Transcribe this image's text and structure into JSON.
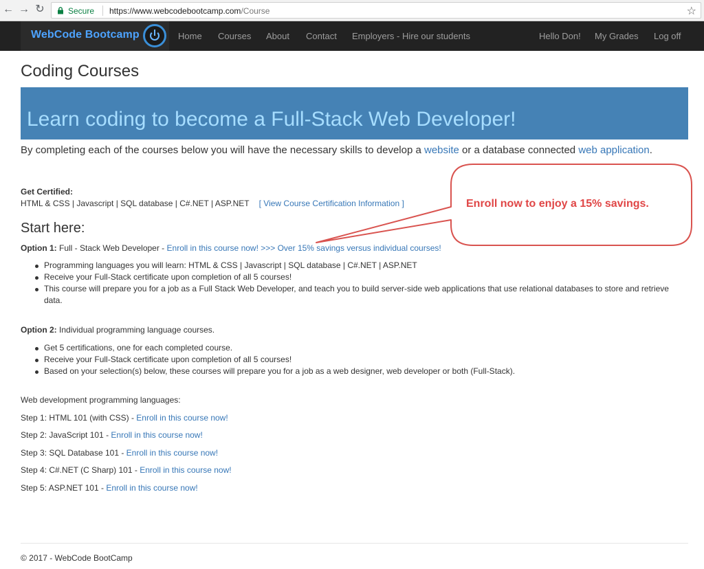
{
  "browser": {
    "secure_label": "Secure",
    "url_host": "https://www.webcodebootcamp.com",
    "url_path": "/Course"
  },
  "navbar": {
    "brand": "WebCode Bootcamp",
    "items": [
      "Home",
      "Courses",
      "About",
      "Contact",
      "Employers - Hire our students"
    ],
    "right_items": [
      "Hello Don!",
      "My Grades",
      "Log off"
    ]
  },
  "content": {
    "page_title": "Coding Courses",
    "jumbotron": "Learn coding to become a Full-Stack Web Developer!",
    "lead_before": "By completing each of the courses below you will have the necessary skills to develop a ",
    "lead_link1": "website",
    "lead_middle": " or a database connected ",
    "lead_link2": "web application",
    "lead_after": ".",
    "cert_heading": "Get Certified:",
    "cert_list": "HTML & CSS | Javascript | SQL database | C#.NET | ASP.NET",
    "cert_link": "[ View Course Certification Information ]",
    "start_heading": "Start here:",
    "option1": {
      "label": "Option 1:",
      "text": " Full - Stack Web Developer - ",
      "link": "Enroll in this course now! >>> Over 15% savings versus individual courses!",
      "bullets": [
        "Programming languages you will learn: HTML & CSS | Javascript | SQL database | C#.NET | ASP.NET",
        "Receive your Full-Stack certificate upon completion of all 5 courses!",
        "This course will prepare you for a job as a Full Stack Web Developer, and teach you to build server-side web applications that use relational databases to store and retrieve data."
      ]
    },
    "option2": {
      "label": "Option 2:",
      "text": " Individual programming language courses.",
      "bullets": [
        "Get 5 certifications, one for each completed course.",
        "Receive your Full-Stack certificate upon completion of all 5 courses!",
        "Based on your selection(s) below, these courses will prepare you for a job as a web designer, web developer or both (Full-Stack)."
      ]
    },
    "webdev_heading": "Web development programming languages:",
    "steps": [
      {
        "text": "Step 1: HTML 101 (with CSS) - ",
        "link": "Enroll in this course now!"
      },
      {
        "text": "Step 2: JavaScript 101 - ",
        "link": "Enroll in this course now!"
      },
      {
        "text": "Step 3: SQL Database 101 - ",
        "link": "Enroll in this course now!"
      },
      {
        "text": "Step 4: C#.NET (C Sharp) 101 - ",
        "link": "Enroll in this course now!"
      },
      {
        "text": "Step 5: ASP.NET 101 - ",
        "link": "Enroll in this course now!"
      }
    ],
    "footer": "© 2017 - WebCode BootCamp"
  },
  "callout": {
    "text": "Enroll now to enjoy a 15% savings."
  },
  "colors": {
    "navbar_bg": "#222222",
    "jumbotron_bg": "#4582b5",
    "jumbotron_text": "#a6ddff",
    "link": "#3777b7",
    "callout_text": "#e04646",
    "callout_border": "#d9534f"
  }
}
